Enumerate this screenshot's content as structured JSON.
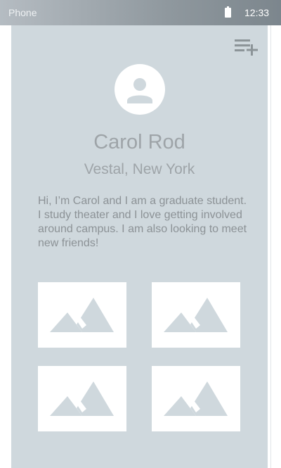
{
  "status_bar": {
    "device_label": "Phone",
    "time": "12:33",
    "battery_icon": "battery-full-icon"
  },
  "header": {
    "action_icon": "playlist-add-icon"
  },
  "profile": {
    "avatar_icon": "person-icon",
    "name": "Carol Rod",
    "location": "Vestal, New York",
    "bio": "Hi, I’m Carol and I am a graduate student. I study theater and I love getting involved around campus. I am also looking to meet new friends!"
  },
  "gallery": {
    "items": [
      {
        "icon": "image-placeholder-icon"
      },
      {
        "icon": "image-placeholder-icon"
      },
      {
        "icon": "image-placeholder-icon"
      },
      {
        "icon": "image-placeholder-icon"
      }
    ]
  },
  "colors": {
    "card_background": "#cfd8dd",
    "text_muted": "#9ea4a8",
    "icon_gray": "#8c9498",
    "placeholder_shape": "#cfd8dd",
    "status_bar_dark": "#7c868d"
  }
}
